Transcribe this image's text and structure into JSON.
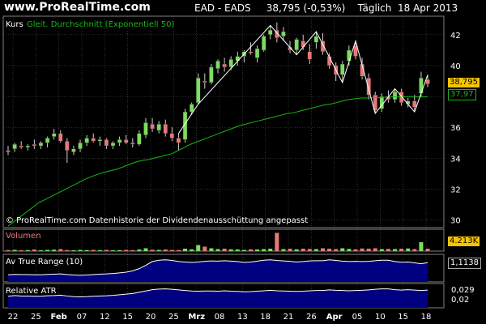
{
  "header": {
    "brand": "www.ProRealTime.com",
    "title": "EAD - EADS     38,795 (-0,53%)    Täglich  18 Apr 2013"
  },
  "main_panel": {
    "legend_kurs": "Kurs",
    "legend_ma": "Gleit. Durchschnitt (Exponentiell 50)",
    "footer": "© ProRealTime.com  Datenhistorie der Dividendenausschüttung angepasst",
    "price_label": "38,795",
    "ma_label": "37,97",
    "y_ticks": [
      "42",
      "40",
      "38",
      "36",
      "34",
      "32",
      "30"
    ]
  },
  "volume_panel": {
    "label": "Volumen",
    "value_label": "4.213K"
  },
  "atr_panel": {
    "label": "Av True Range (10)",
    "value_label": "1,1138"
  },
  "ratr_panel": {
    "label": "Relative ATR",
    "value_label": "0,029",
    "value_label2": "0,02"
  },
  "x_labels": [
    "22",
    "25",
    "Feb",
    "07",
    "12",
    "15",
    "20",
    "25",
    "Mrz",
    "08",
    "13",
    "18",
    "21",
    "26",
    "Apr",
    "05",
    "10",
    "15",
    "18"
  ],
  "colors": {
    "up": "#7ddc5f",
    "down": "#e87878",
    "ma": "#18b818",
    "grid": "#5f5f5f",
    "atr_fill": "#000080",
    "background": "#000000",
    "panel_bg": "#000000"
  },
  "chart_data": {
    "type": "candlestick",
    "ylim": [
      29.5,
      43.2
    ],
    "candles": [
      [
        34.5,
        34.8,
        34.2,
        34.4
      ],
      [
        34.6,
        35.0,
        34.4,
        34.9
      ],
      [
        34.8,
        35.1,
        34.6,
        34.7
      ],
      [
        34.7,
        34.9,
        34.5,
        34.8
      ],
      [
        34.9,
        35.2,
        34.6,
        34.8
      ],
      [
        34.8,
        35.1,
        34.6,
        35.0
      ],
      [
        35.0,
        35.4,
        34.7,
        35.3
      ],
      [
        35.4,
        35.9,
        35.2,
        35.6
      ],
      [
        35.6,
        35.8,
        35.0,
        35.1
      ],
      [
        35.1,
        35.3,
        33.7,
        34.5
      ],
      [
        34.4,
        34.8,
        34.2,
        34.6
      ],
      [
        34.6,
        35.2,
        34.4,
        35.0
      ],
      [
        35.0,
        35.5,
        34.8,
        35.3
      ],
      [
        35.3,
        35.6,
        35.0,
        35.1
      ],
      [
        35.1,
        35.4,
        34.8,
        35.2
      ],
      [
        35.2,
        35.3,
        34.6,
        34.8
      ],
      [
        34.8,
        35.1,
        34.6,
        35.0
      ],
      [
        35.0,
        35.4,
        34.8,
        35.2
      ],
      [
        35.2,
        35.5,
        34.9,
        35.0
      ],
      [
        35.0,
        35.3,
        34.7,
        34.9
      ],
      [
        34.9,
        35.8,
        34.8,
        35.6
      ],
      [
        35.5,
        36.6,
        35.3,
        36.3
      ],
      [
        36.2,
        36.6,
        35.7,
        35.9
      ],
      [
        35.8,
        36.4,
        35.6,
        36.2
      ],
      [
        36.2,
        36.5,
        35.4,
        35.6
      ],
      [
        35.6,
        36.0,
        35.1,
        35.3
      ],
      [
        35.3,
        35.6,
        34.5,
        35.0
      ],
      [
        35.2,
        37.2,
        35.0,
        37.0
      ],
      [
        37.0,
        37.6,
        36.8,
        37.5
      ],
      [
        37.6,
        39.5,
        37.5,
        39.2
      ],
      [
        39.0,
        39.5,
        38.5,
        38.9
      ],
      [
        38.9,
        40.1,
        38.8,
        39.9
      ],
      [
        39.8,
        40.4,
        39.5,
        40.3
      ],
      [
        40.1,
        40.5,
        39.6,
        39.9
      ],
      [
        39.9,
        40.6,
        39.7,
        40.4
      ],
      [
        40.3,
        40.9,
        40.0,
        40.6
      ],
      [
        40.6,
        41.0,
        40.2,
        40.9
      ],
      [
        40.9,
        41.5,
        40.7,
        40.8
      ],
      [
        40.5,
        41.3,
        40.2,
        41.1
      ],
      [
        41.0,
        42.0,
        40.9,
        41.9
      ],
      [
        42.0,
        42.6,
        41.7,
        42.3
      ],
      [
        42.3,
        42.8,
        41.5,
        41.8
      ],
      [
        41.9,
        42.5,
        41.6,
        42.2
      ],
      [
        41.2,
        41.6,
        40.8,
        41.0
      ],
      [
        41.0,
        41.8,
        40.7,
        41.7
      ],
      [
        41.6,
        42.0,
        41.0,
        41.2
      ],
      [
        40.9,
        41.4,
        40.1,
        40.4
      ],
      [
        41.5,
        42.2,
        41.1,
        41.9
      ],
      [
        41.6,
        42.1,
        40.7,
        40.9
      ],
      [
        40.6,
        40.8,
        39.8,
        40.0
      ],
      [
        40.0,
        40.2,
        39.0,
        39.4
      ],
      [
        39.4,
        40.3,
        38.9,
        40.1
      ],
      [
        40.3,
        41.3,
        40.0,
        41.0
      ],
      [
        41.3,
        41.6,
        40.4,
        40.6
      ],
      [
        40.1,
        40.5,
        39.1,
        39.3
      ],
      [
        39.2,
        39.5,
        37.8,
        38.1
      ],
      [
        38.1,
        38.3,
        36.9,
        37.1
      ],
      [
        37.2,
        38.2,
        37.0,
        38.0
      ],
      [
        38.0,
        38.4,
        37.6,
        37.8
      ],
      [
        37.8,
        38.5,
        37.6,
        38.3
      ],
      [
        38.3,
        38.5,
        37.4,
        37.6
      ],
      [
        37.5,
        37.9,
        37.3,
        37.7
      ],
      [
        37.7,
        38.1,
        37.0,
        37.3
      ],
      [
        38.2,
        39.6,
        38.0,
        39.2
      ],
      [
        39.1,
        39.4,
        38.6,
        38.8
      ]
    ],
    "ma": [
      29.6,
      29.9,
      30.2,
      30.5,
      30.8,
      31.1,
      31.3,
      31.5,
      31.7,
      31.9,
      32.1,
      32.3,
      32.5,
      32.7,
      32.85,
      33.0,
      33.1,
      33.2,
      33.3,
      33.45,
      33.6,
      33.75,
      33.85,
      33.9,
      34.0,
      34.1,
      34.2,
      34.3,
      34.5,
      34.7,
      34.9,
      35.05,
      35.2,
      35.35,
      35.5,
      35.65,
      35.8,
      35.95,
      36.1,
      36.2,
      36.3,
      36.4,
      36.5,
      36.6,
      36.7,
      36.8,
      36.9,
      36.95,
      37.05,
      37.15,
      37.25,
      37.35,
      37.45,
      37.5,
      37.6,
      37.7,
      37.8,
      37.85,
      37.9,
      37.9,
      37.92,
      37.94,
      37.95,
      37.97,
      37.97,
      37.97,
      37.97,
      37.97,
      37.97,
      37.97
    ],
    "volume": [
      0.05,
      0.06,
      0.04,
      0.05,
      0.08,
      0.04,
      0.06,
      0.07,
      0.1,
      0.05,
      0.04,
      0.06,
      0.05,
      0.06,
      0.05,
      0.06,
      0.04,
      0.05,
      0.06,
      0.05,
      0.08,
      0.14,
      0.07,
      0.06,
      0.08,
      0.06,
      0.05,
      0.12,
      0.09,
      0.3,
      0.22,
      0.14,
      0.1,
      0.12,
      0.09,
      0.08,
      0.06,
      0.09,
      0.08,
      0.1,
      0.12,
      0.9,
      0.1,
      0.12,
      0.09,
      0.12,
      0.11,
      0.1,
      0.14,
      0.12,
      0.1,
      0.14,
      0.11,
      0.09,
      0.13,
      0.12,
      0.14,
      0.1,
      0.11,
      0.1,
      0.12,
      0.13,
      0.1,
      0.44,
      0.12
    ],
    "atr": [
      0.32,
      0.34,
      0.33,
      0.33,
      0.32,
      0.32,
      0.34,
      0.35,
      0.36,
      0.33,
      0.31,
      0.3,
      0.31,
      0.33,
      0.35,
      0.36,
      0.38,
      0.41,
      0.44,
      0.5,
      0.6,
      0.75,
      0.92,
      0.98,
      1.0,
      0.97,
      0.92,
      0.9,
      0.88,
      0.9,
      0.93,
      0.95,
      0.94,
      0.96,
      0.94,
      0.92,
      0.88,
      0.9,
      0.94,
      0.98,
      1.0,
      0.97,
      0.95,
      0.93,
      0.9,
      0.92,
      0.95,
      0.96,
      0.96,
      1.0,
      0.97,
      0.94,
      0.92,
      0.93,
      0.92,
      0.93,
      0.96,
      0.98,
      0.98,
      0.92,
      0.89,
      0.9,
      0.86,
      0.82,
      0.87
    ],
    "ratr": [
      0.55,
      0.58,
      0.56,
      0.56,
      0.55,
      0.55,
      0.57,
      0.58,
      0.6,
      0.56,
      0.53,
      0.52,
      0.53,
      0.55,
      0.56,
      0.57,
      0.59,
      0.62,
      0.65,
      0.68,
      0.74,
      0.8,
      0.86,
      0.89,
      0.9,
      0.88,
      0.85,
      0.82,
      0.8,
      0.79,
      0.8,
      0.8,
      0.79,
      0.81,
      0.79,
      0.78,
      0.76,
      0.77,
      0.79,
      0.81,
      0.83,
      0.81,
      0.8,
      0.79,
      0.78,
      0.79,
      0.81,
      0.82,
      0.82,
      0.85,
      0.83,
      0.82,
      0.81,
      0.82,
      0.83,
      0.85,
      0.88,
      0.9,
      0.9,
      0.86,
      0.84,
      0.86,
      0.84,
      0.82,
      0.84
    ]
  }
}
